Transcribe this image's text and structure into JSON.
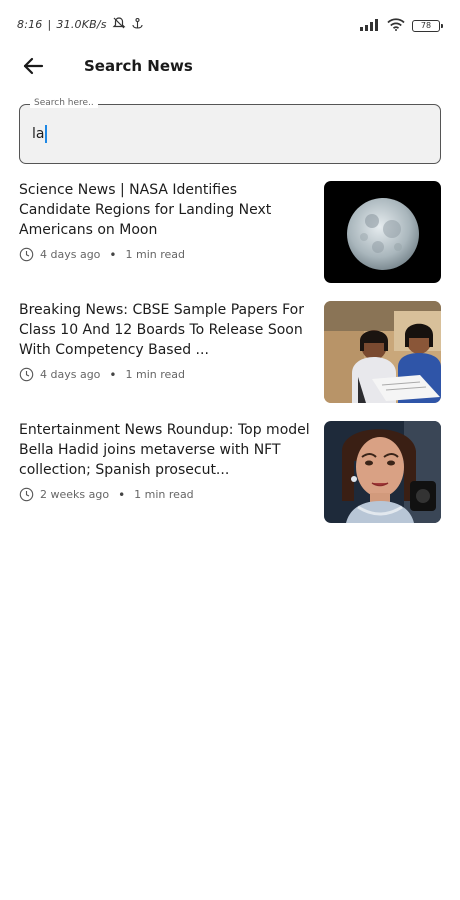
{
  "status_bar": {
    "time": "8:16",
    "network_speed": "31.0KB/s",
    "battery": "78",
    "icons": [
      "muted-bell-icon",
      "anchor-icon",
      "signal-icon",
      "wifi-icon",
      "battery-icon"
    ]
  },
  "app_bar": {
    "back_icon": "arrow-left-icon",
    "title": "Search News"
  },
  "search": {
    "label": "Search here..",
    "value": "la"
  },
  "news": [
    {
      "title": "Science News | NASA Identifies Candidate Regions for Landing Next Americans on Moon",
      "age": "4 days ago",
      "read_time": "1 min read",
      "thumbnail": "moon-image"
    },
    {
      "title": "Breaking News: CBSE Sample Papers For Class 10 And 12 Boards To Release Soon With Competency Based ...",
      "age": "4 days ago",
      "read_time": "1 min read",
      "thumbnail": "students-image"
    },
    {
      "title": "Entertainment News Roundup: Top model Bella Hadid joins metaverse with NFT collection; Spanish prosecut...",
      "age": "2 weeks ago",
      "read_time": "1 min read",
      "thumbnail": "model-image"
    }
  ]
}
